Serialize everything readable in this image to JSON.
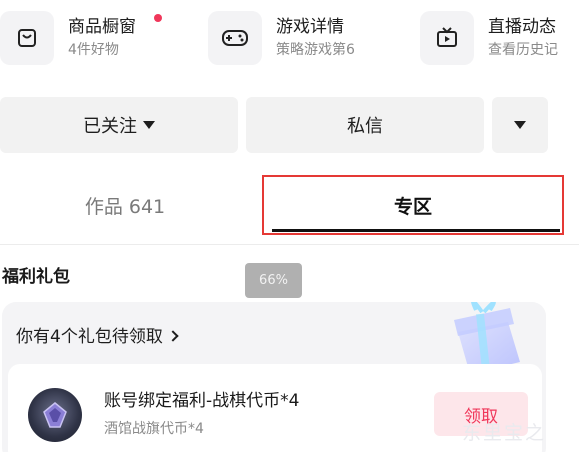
{
  "shortcuts": [
    {
      "title": "商品橱窗",
      "subtitle": "4件好物",
      "icon": "shopping-bag-icon"
    },
    {
      "title": "游戏详情",
      "subtitle": "策略游戏第6",
      "icon": "gamepad-icon"
    },
    {
      "title": "直播动态",
      "subtitle": "查看历史记",
      "icon": "tv-icon"
    }
  ],
  "actions": {
    "follow_label": "已关注",
    "message_label": "私信"
  },
  "tabs": [
    {
      "label": "作品 641",
      "active": false
    },
    {
      "label": "专区",
      "active": true
    }
  ],
  "section": {
    "title": "福利礼包"
  },
  "zoom": "66%",
  "gift": {
    "header": "你有4个礼包待领取",
    "item": {
      "title": "账号绑定福利-战棋代币*4",
      "subtitle": "酒馆战旗代币*4",
      "claim_label": "领取"
    }
  },
  "watermark": "东里宝之",
  "colors": {
    "accent": "#f0375a",
    "highlight_border": "#e53935",
    "card_bg": "#f4f4f6"
  }
}
